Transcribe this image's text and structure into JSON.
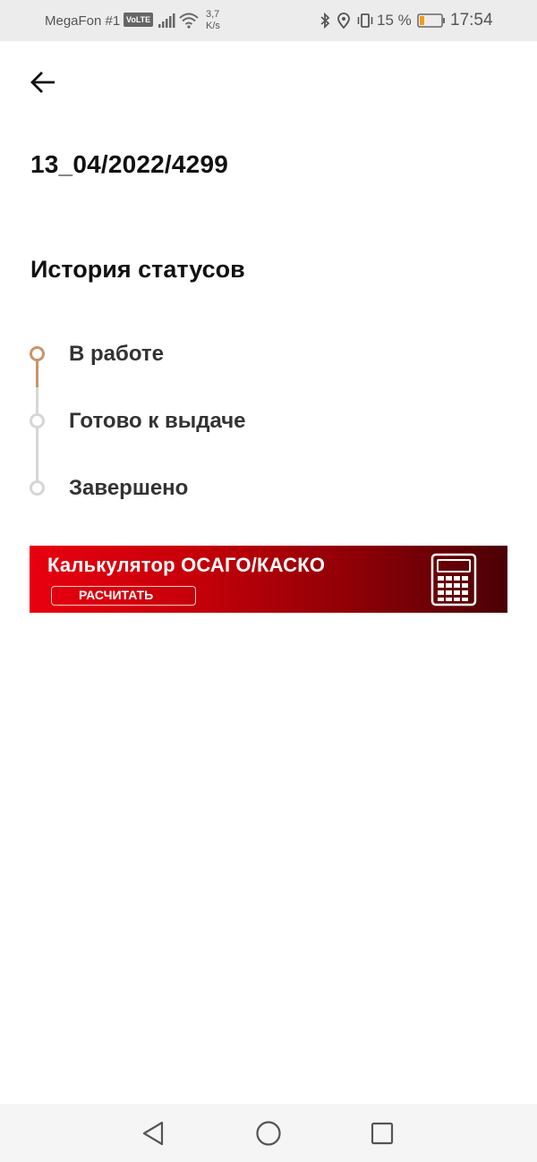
{
  "status_bar": {
    "carrier": "MegaFon #1",
    "volte": "VoLTE",
    "speed_value": "3,7",
    "speed_unit": "K/s",
    "battery_percent": "15 %",
    "time": "17:54",
    "icons": [
      "signal-icon",
      "wifi-icon",
      "bluetooth-icon",
      "location-icon",
      "vibrate-icon",
      "battery-icon"
    ]
  },
  "header": {
    "back_icon": "arrow-left-icon",
    "document_number": "13_04/2022/4299"
  },
  "status_history": {
    "title": "История статусов",
    "items": [
      {
        "label": "В работе",
        "active": true
      },
      {
        "label": "Готово к выдаче",
        "active": false
      },
      {
        "label": "Завершено",
        "active": false
      }
    ]
  },
  "banner": {
    "title": "Калькулятор ОСАГО/КАСКО",
    "button_label": "РАСЧИТАТЬ",
    "icon": "calculator-icon"
  },
  "nav_bar": {
    "buttons": [
      "back-triangle-icon",
      "home-circle-icon",
      "recents-square-icon"
    ]
  },
  "colors": {
    "active": "#c8956a",
    "inactive": "#d6d6d6",
    "banner_start": "#e8000f",
    "banner_end": "#4a0005"
  }
}
